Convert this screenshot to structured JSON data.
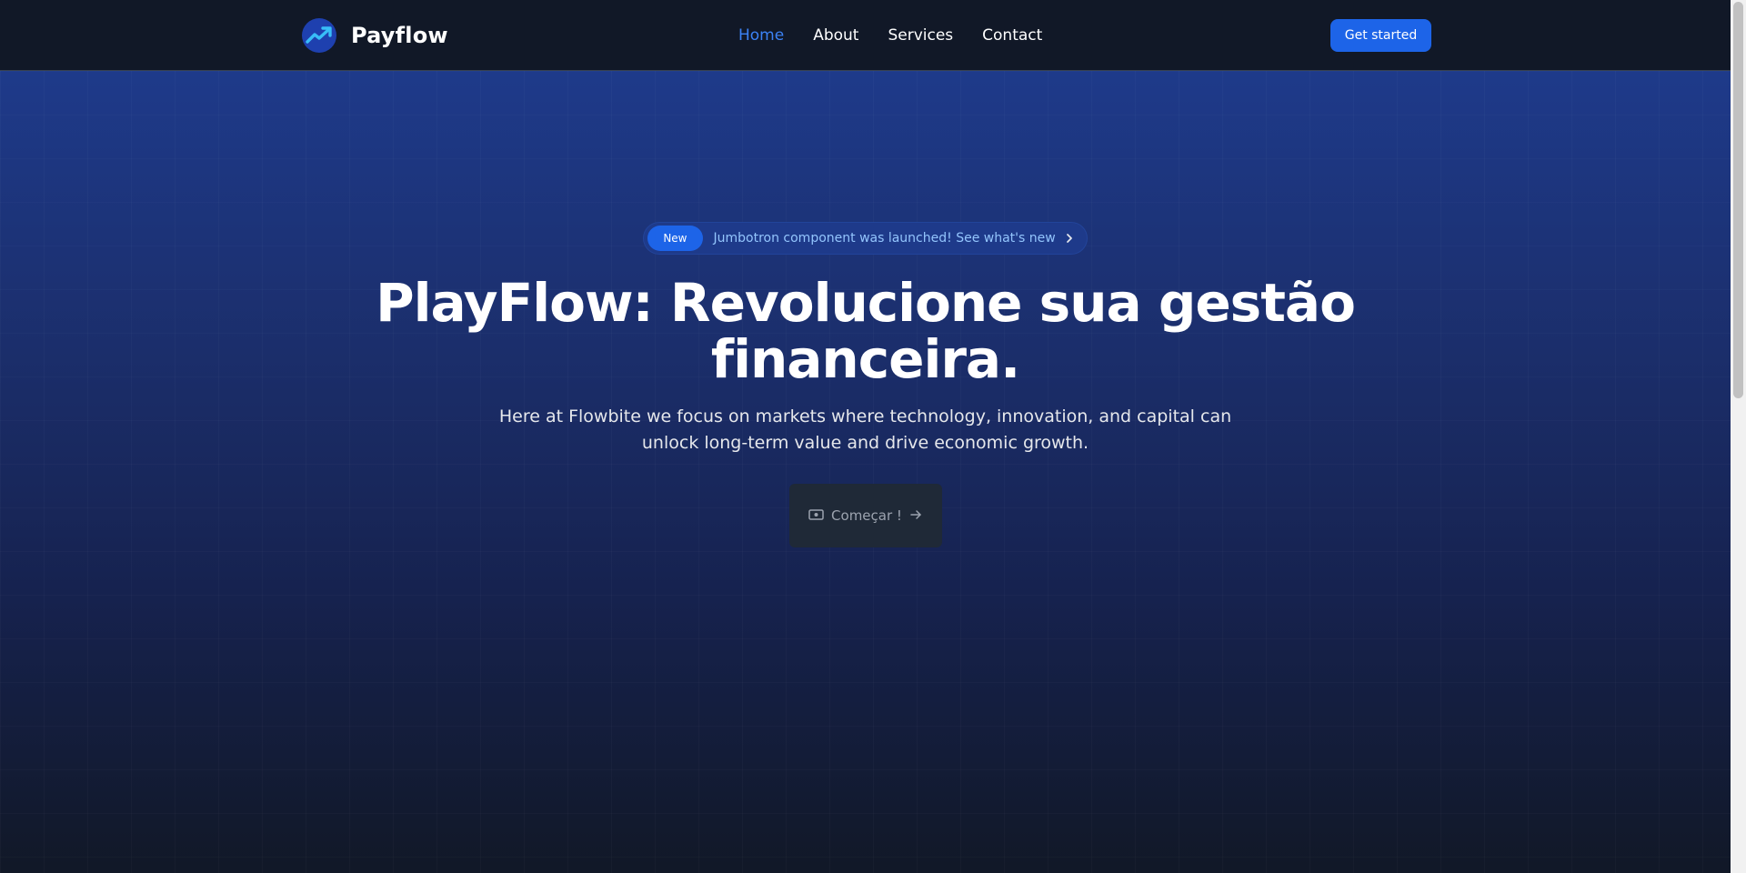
{
  "nav": {
    "brand": "Payflow",
    "links": [
      "Home",
      "About",
      "Services",
      "Contact"
    ],
    "cta": "Get started",
    "active_color": "#3b82f6"
  },
  "hero": {
    "badge": "New",
    "announcement": "Jumbotron component was launched! See what's new",
    "headline": "PlayFlow: Revolucione sua gestão financeira.",
    "subtext": "Here at Flowbite we focus on markets where technology, innovation, and capital can unlock long-term value and drive economic growth.",
    "button": "Começar !"
  },
  "colors": {
    "accent": "#1d64e8",
    "background": "#111827",
    "hero_gradient_top": "#1e3a8a"
  },
  "icons": {
    "logo": "trending-up-icon",
    "announcement": "chevron-right-icon",
    "button_leading": "cash-icon",
    "button_trailing": "arrow-right-icon"
  }
}
